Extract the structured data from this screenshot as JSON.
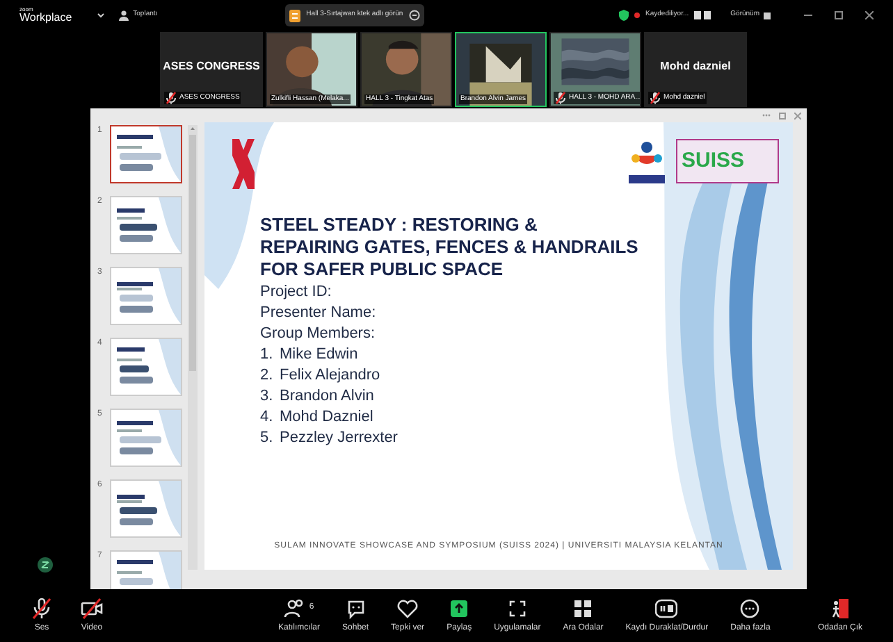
{
  "top_bar": {
    "brand_small": "zoom",
    "brand": "Workplace",
    "meeting_label": "Toplantı",
    "share_banner": "Hall 3-Sırtajwan ktek adlı görün",
    "recording": "Kaydediliyor...",
    "view": "Görünüm"
  },
  "video_tiles": [
    {
      "kind": "name",
      "display_name": "ASES CONGRESS",
      "label": "ASES CONGRESS",
      "muted": true,
      "active": false
    },
    {
      "kind": "video",
      "label": "Zulkifli Hassan (Melaka...",
      "muted": false,
      "active": false
    },
    {
      "kind": "video",
      "label": "HALL 3 - Tingkat Atas",
      "muted": false,
      "active": false
    },
    {
      "kind": "video",
      "label": "Brandon Alvin James",
      "muted": false,
      "active": true
    },
    {
      "kind": "video",
      "label": "HALL 3 - MOHD ARA...",
      "muted": true,
      "active": false
    },
    {
      "kind": "name",
      "display_name": "Mohd dazniel",
      "label": "Mohd dazniel",
      "muted": true,
      "active": false
    }
  ],
  "thumbnails": [
    {
      "number": "1",
      "selected": true
    },
    {
      "number": "2",
      "selected": false
    },
    {
      "number": "3",
      "selected": false
    },
    {
      "number": "4",
      "selected": false
    },
    {
      "number": "5",
      "selected": false
    },
    {
      "number": "6",
      "selected": false
    },
    {
      "number": "7",
      "selected": false
    }
  ],
  "slide": {
    "logo_text": "SUISS",
    "title": "STEEL STEADY : RESTORING & REPAIRING GATES, FENCES & HANDRAILS FOR SAFER PUBLIC SPACE",
    "lines": [
      "Project ID:",
      "Presenter Name:",
      "Group Members:"
    ],
    "members": [
      {
        "number": "1.",
        "name": "Mike Edwin"
      },
      {
        "number": "2.",
        "name": "Felix Alejandro"
      },
      {
        "number": "3.",
        "name": "Brandon Alvin"
      },
      {
        "number": "4.",
        "name": "Mohd Dazniel"
      },
      {
        "number": "5.",
        "name": "Pezzley Jerrexter"
      }
    ],
    "footer": "SULAM INNOVATE SHOWCASE AND SYMPOSIUM (SUISS 2024) | UNIVERSITI MALAYSIA KELANTAN"
  },
  "toolbar": [
    {
      "kind": "mic",
      "label": "Ses",
      "muted": true
    },
    {
      "kind": "camera",
      "label": "Video",
      "muted": true
    },
    {
      "kind": "participants",
      "label": "Katılımcılar",
      "count": "6"
    },
    {
      "kind": "chat",
      "label": "Sohbet"
    },
    {
      "kind": "react",
      "label": "Tepki ver"
    },
    {
      "kind": "share",
      "label": "Paylaş"
    },
    {
      "kind": "apps",
      "label": "Uygulamalar"
    },
    {
      "kind": "rooms",
      "label": "Ara Odalar"
    },
    {
      "kind": "record",
      "label": "Kaydı Duraklat/Durdur"
    },
    {
      "kind": "more",
      "label": "Daha fazla"
    },
    {
      "kind": "leave",
      "label": "Odadan Çık"
    }
  ]
}
